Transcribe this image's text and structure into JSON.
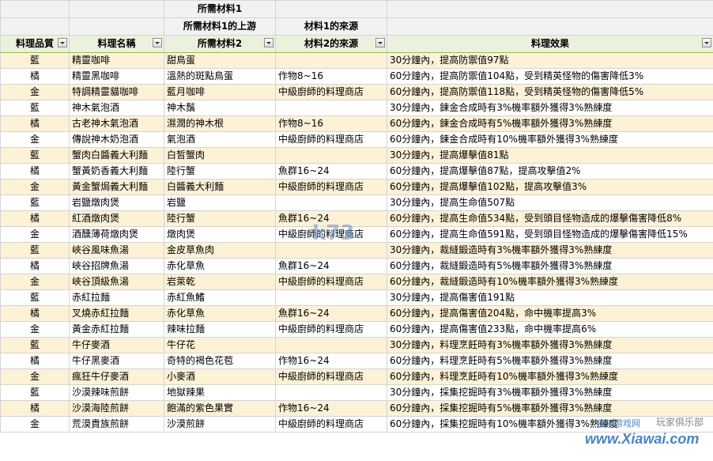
{
  "header_top": {
    "material1_title": "所需材料1",
    "material1_upstream": "所需材料1的上游",
    "material1_source": "材料1的來源"
  },
  "columns": [
    "料理品質",
    "料理名稱",
    "所需材料2",
    "材料2的來源",
    "料理效果"
  ],
  "rows": [
    [
      "藍",
      "精靈咖啡",
      "甜鳥蛋",
      "",
      "30分鐘內，提高防禦值97點"
    ],
    [
      "橘",
      "精靈黑咖啡",
      "溫熱的斑點鳥蛋",
      "作物8~16",
      "60分鐘內，提高防禦值104點，受到精英怪物的傷害降低3%"
    ],
    [
      "金",
      "特調精靈貓咖啡",
      "藍月咖啡",
      "中級廚師的料理商店",
      "60分鐘內，提高防禦值118點，受到精英怪物的傷害降低5%"
    ],
    [
      "藍",
      "神木氣泡酒",
      "神木鬚",
      "",
      "30分鐘內，鍊金合成時有3%機率額外獲得3%熟練度"
    ],
    [
      "橘",
      "古老神木氣泡酒",
      "濕潤的神木根",
      "作物8~16",
      "60分鐘內，鍊金合成時有5%機率額外獲得3%熟練度"
    ],
    [
      "金",
      "傳說神木奶泡酒",
      "氣泡酒",
      "中級廚師的料理商店",
      "60分鐘內，鍊金合成時有10%機率額外獲得3%熟練度"
    ],
    [
      "藍",
      "蟹肉白醬義大利麵",
      "白皙蟹肉",
      "",
      "30分鐘內，提高爆擊值81點"
    ],
    [
      "橘",
      "蟹黃奶香義大利麵",
      "陸行蟹",
      "魚群16~24",
      "60分鐘內，提高爆擊值87點，提高攻擊值2%"
    ],
    [
      "金",
      "黃金蟹焗義大利麵",
      "白醬義大利麵",
      "中級廚師的料理商店",
      "60分鐘內，提高爆擊值102點，提高攻擊值3%"
    ],
    [
      "藍",
      "岩鹽燉肉煲",
      "岩鹽",
      "",
      "30分鐘內，提高生命值507點"
    ],
    [
      "橘",
      "紅酒燉肉煲",
      "陸行蟹",
      "魚群16~24",
      "60分鐘內，提高生命值534點，受到頭目怪物造成的爆擊傷害降低8%"
    ],
    [
      "金",
      "酒醺薄荷燉肉煲",
      "燉肉煲",
      "中級廚師的料理商店",
      "60分鐘內，提高生命值591點，受到頭目怪物造成的爆擊傷害降低15%"
    ],
    [
      "藍",
      "峽谷風味魚湯",
      "金皮草魚肉",
      "",
      "30分鐘內，裁縫鍛造時有3%機率額外獲得3%熟練度"
    ],
    [
      "橘",
      "峽谷招牌魚湯",
      "赤化草魚",
      "魚群16~24",
      "60分鐘內，裁縫鍛造時有5%機率額外獲得3%熟練度"
    ],
    [
      "金",
      "峽谷頂級魚湯",
      "岩萊乾",
      "中級廚師的料理商店",
      "60分鐘內，裁縫鍛造時有10%機率額外獲得3%熟練度"
    ],
    [
      "藍",
      "赤紅拉麵",
      "赤紅魚鰭",
      "",
      "30分鐘內，提高傷害值191點"
    ],
    [
      "橘",
      "叉燒赤紅拉麵",
      "赤化草魚",
      "魚群16~24",
      "60分鐘內，提高傷害值204點，命中機率提高3%"
    ],
    [
      "金",
      "黃金赤紅拉麵",
      "辣味拉麵",
      "中級廚師的料理商店",
      "60分鐘內，提高傷害值233點，命中機率提高6%"
    ],
    [
      "藍",
      "牛仔麥酒",
      "牛仔花",
      "",
      "30分鐘內，料理烹飪時有3%機率額外獲得3%熟練度"
    ],
    [
      "橘",
      "牛仔黑麥酒",
      "奇特的褐色花苞",
      "作物16~24",
      "60分鐘內，料理烹飪時有5%機率額外獲得3%熟練度"
    ],
    [
      "金",
      "瘋狂牛仔麥酒",
      "小麥酒",
      "中級廚師的料理商店",
      "60分鐘內，料理烹飪時有10%機率額外獲得3%熟練度"
    ],
    [
      "藍",
      "沙漠辣味煎餅",
      "地獄辣果",
      "",
      "30分鐘內，採集挖掘時有3%機率額外獲得3%熟練度"
    ],
    [
      "橘",
      "沙漠海陸煎餅",
      "飽滿的紫色果實",
      "作物16~24",
      "60分鐘內，採集挖掘時有5%機率額外獲得3%熟練度"
    ],
    [
      "金",
      "荒漠貴族煎餅",
      "沙漠煎餅",
      "中級廚師的料理商店",
      "60分鐘內，採集挖掘時有10%機率額外獲得3%熟練度"
    ]
  ],
  "watermarks": {
    "k73": "k73",
    "xiawai": "www.Xiawai.com",
    "xiawai_cn": "侠外游戏网",
    "club": "玩家俱乐部"
  }
}
